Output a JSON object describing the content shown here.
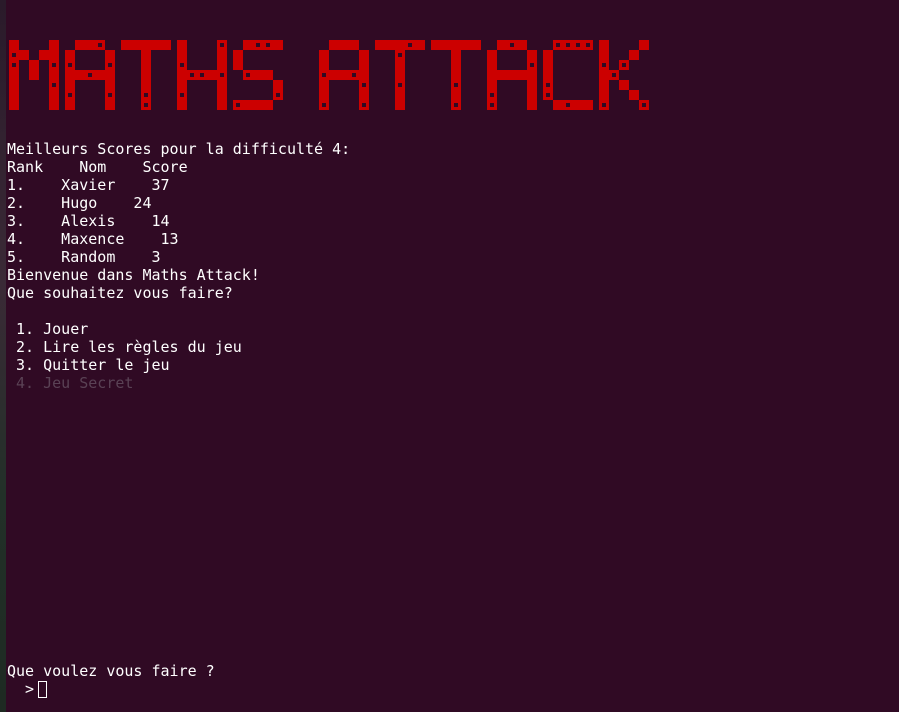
{
  "title_banner": "MATHS ATTACK !",
  "colors": {
    "background": "#300a24",
    "banner": "#cc0000",
    "text": "#ffffff",
    "disabled": "#5a4255"
  },
  "scores": {
    "heading": "Meilleurs Scores pour la difficulté 4:",
    "header": "Rank    Nom    Score",
    "rows": [
      "1.    Xavier    37",
      "2.    Hugo    24",
      "3.    Alexis    14",
      "4.    Maxence    13",
      "5.    Random    3"
    ]
  },
  "welcome": "Bienvenue dans Maths Attack!",
  "question": "Que souhaitez vous faire?",
  "menu": [
    " 1. Jouer",
    " 2. Lire les règles du jeu",
    " 3. Quitter le jeu",
    " 4. Jeu Secret"
  ],
  "prompt": {
    "question": "Que voulez vous faire ?",
    "symbol": "  >"
  }
}
